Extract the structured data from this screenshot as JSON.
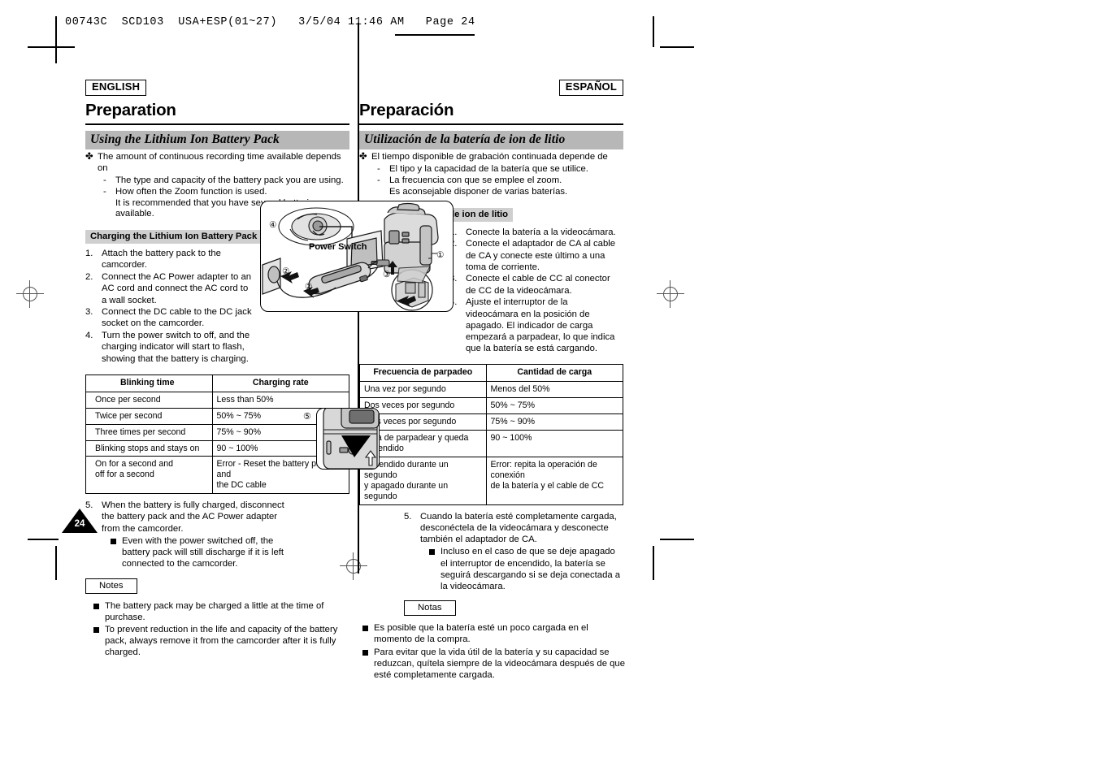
{
  "print_header": {
    "text": "00743C  SCD103  USA+ESP(01~27)   3/5/04 11:46 AM   Page 24"
  },
  "page_number": "24",
  "colors": {
    "bar_gray": "#b7b7b7",
    "subhead_gray": "#cfcfcf",
    "rule_black": "#000000"
  },
  "english": {
    "language_badge": "ENGLISH",
    "section_title": "Preparation",
    "bar_heading": "Using the Lithium Ion Battery Pack",
    "lead": {
      "marker": "✤",
      "text": "The amount of continuous recording time available depends on",
      "sub_items": [
        "The type and capacity of the battery pack you are using.",
        "How often the Zoom function is used."
      ],
      "sub_note": "It is recommended that you have several batteries available."
    },
    "sub_heading": "Charging the Lithium Ion Battery Pack",
    "steps": [
      {
        "n": "1.",
        "text": "Attach the battery pack to the camcorder."
      },
      {
        "n": "2.",
        "text": "Connect the AC Power adapter to an AC cord and connect the AC cord to a wall socket."
      },
      {
        "n": "3.",
        "text": "Connect the DC cable to the DC jack socket on the camcorder."
      },
      {
        "n": "4.",
        "text": "Turn the power switch to off, and the charging indicator will start to flash, showing that the battery is charging."
      }
    ],
    "table": {
      "headers": [
        "Blinking time",
        "Charging rate"
      ],
      "rows": [
        [
          "Once per second",
          "Less than 50%"
        ],
        [
          "Twice per second",
          "50% ~ 75%"
        ],
        [
          "Three times per second",
          "75%  ~  90%"
        ],
        [
          "Blinking stops and stays on",
          "90 ~ 100%"
        ],
        [
          "On for a second and\noff for a second",
          "Error - Reset the battery pack and\nthe DC cable"
        ]
      ]
    },
    "step5": {
      "n": "5.",
      "text": "When the battery is fully charged, disconnect the battery pack and the AC Power adapter from the camcorder.",
      "bullet": "Even with the power switched off, the battery pack will still discharge if it is left connected to the camcorder."
    },
    "notes_label": "Notes",
    "notes": [
      "The battery pack may be charged a little at the time of purchase.",
      "To prevent reduction in the life and capacity of the battery pack, always remove it from the camcorder after it is fully charged."
    ]
  },
  "spanish": {
    "language_badge": "ESPAÑOL",
    "section_title": "Preparación",
    "bar_heading": "Utilización de la batería de ion de litio",
    "lead": {
      "marker": "✤",
      "text": "El tiempo disponible de grabación continuada depende de",
      "sub_items": [
        "El tipo y la capacidad de la batería que se utilice.",
        "La frecuencia con que se emplee el zoom."
      ],
      "sub_note": "Es aconsejable disponer de varias baterías."
    },
    "sub_heading": "Carga de la batería de ion de litio",
    "steps": [
      {
        "n": "1.",
        "text": "Conecte la batería a la videocámara."
      },
      {
        "n": "2.",
        "text": "Conecte el adaptador de CA al cable de CA y conecte este último a una toma de corriente."
      },
      {
        "n": "3.",
        "text": "Conecte el cable de CC al conector de CC de la videocámara."
      },
      {
        "n": "4.",
        "text": "Ajuste el interruptor de la videocámara en la posición de apagado. El indicador de carga empezará a parpadear, lo que indica que la batería se está cargando."
      }
    ],
    "table": {
      "headers": [
        "Frecuencia de parpadeo",
        "Cantidad de carga"
      ],
      "rows": [
        [
          "Una vez por segundo",
          "Menos del 50%"
        ],
        [
          "Dos veces por segundo",
          "50% ~ 75%"
        ],
        [
          "Tres veces por segundo",
          "75%  ~  90%"
        ],
        [
          "Deja de parpadear y queda encendido",
          "90 ~ 100%"
        ],
        [
          "Encendido durante un segundo\ny apagado durante un segundo",
          "Error: repita la operación de conexión\nde la batería y el cable de CC"
        ]
      ]
    },
    "step5": {
      "n": "5.",
      "text": "Cuando la batería esté completamente cargada, desconéctela de la videocámara y desconecte también el adaptador de CA.",
      "bullet": "Incluso en el caso de que se deje apagado el interruptor de encendido, la batería se seguirá descargando si se deja conectada a la videocámara."
    },
    "notes_label": "Notas",
    "notes": [
      "Es posible que la batería esté un poco cargada en el momento de la compra.",
      "Para evitar que la vida útil de la batería y su capacidad se reduzcan, quítela siempre de la videocámara después de que esté completamente cargada."
    ]
  },
  "illustration": {
    "power_switch_label": "Power Switch",
    "callouts": [
      "①",
      "②",
      "②",
      "③",
      "④"
    ],
    "small_callout": "⑤"
  }
}
